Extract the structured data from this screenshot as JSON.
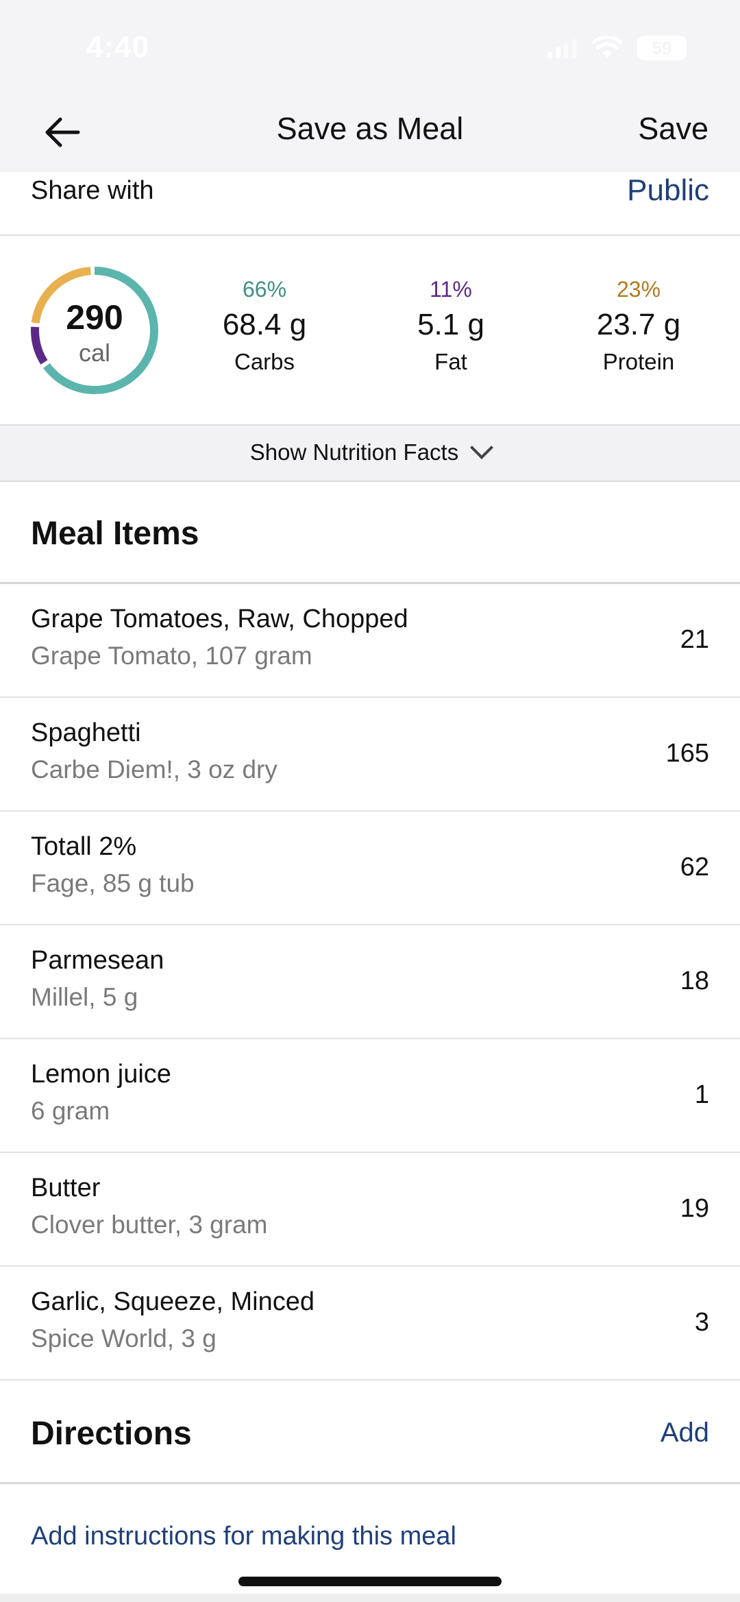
{
  "status_bar": {
    "time": "4:40",
    "battery": "59"
  },
  "nav": {
    "title": "Save as Meal",
    "save_label": "Save"
  },
  "share": {
    "label": "Share with",
    "value": "Public"
  },
  "summary": {
    "calories": "290",
    "calories_unit": "cal",
    "macros": [
      {
        "pct": "66%",
        "grams": "68.4 g",
        "name": "Carbs",
        "color": "#5bb5ad",
        "fraction": 0.66
      },
      {
        "pct": "11%",
        "grams": "5.1 g",
        "name": "Fat",
        "color": "#5b2a86",
        "fraction": 0.11
      },
      {
        "pct": "23%",
        "grams": "23.7 g",
        "name": "Protein",
        "color": "#e9b04f",
        "fraction": 0.23
      }
    ]
  },
  "nutrition_toggle": {
    "label": "Show Nutrition Facts"
  },
  "meal_items": {
    "heading": "Meal Items",
    "items": [
      {
        "name": "Grape Tomatoes, Raw, Chopped",
        "desc": "Grape Tomato, 107 gram",
        "cal": "21"
      },
      {
        "name": "Spaghetti",
        "desc": "Carbe Diem!, 3 oz dry",
        "cal": "165"
      },
      {
        "name": "Totall 2%",
        "desc": "Fage, 85 g tub",
        "cal": "62"
      },
      {
        "name": "Parmesean",
        "desc": "Millel, 5 g",
        "cal": "18"
      },
      {
        "name": "Lemon juice",
        "desc": "6 gram",
        "cal": "1"
      },
      {
        "name": "Butter",
        "desc": "Clover butter, 3 gram",
        "cal": "19"
      },
      {
        "name": "Garlic, Squeeze, Minced",
        "desc": "Spice World, 3 g",
        "cal": "3"
      }
    ]
  },
  "directions": {
    "heading": "Directions",
    "add_label": "Add",
    "instructions_link": "Add instructions for making this meal"
  },
  "colors": {
    "link": "#1f3f7a",
    "carbs": "#5bb5ad",
    "fat": "#5b2a86",
    "protein": "#e9b04f"
  }
}
